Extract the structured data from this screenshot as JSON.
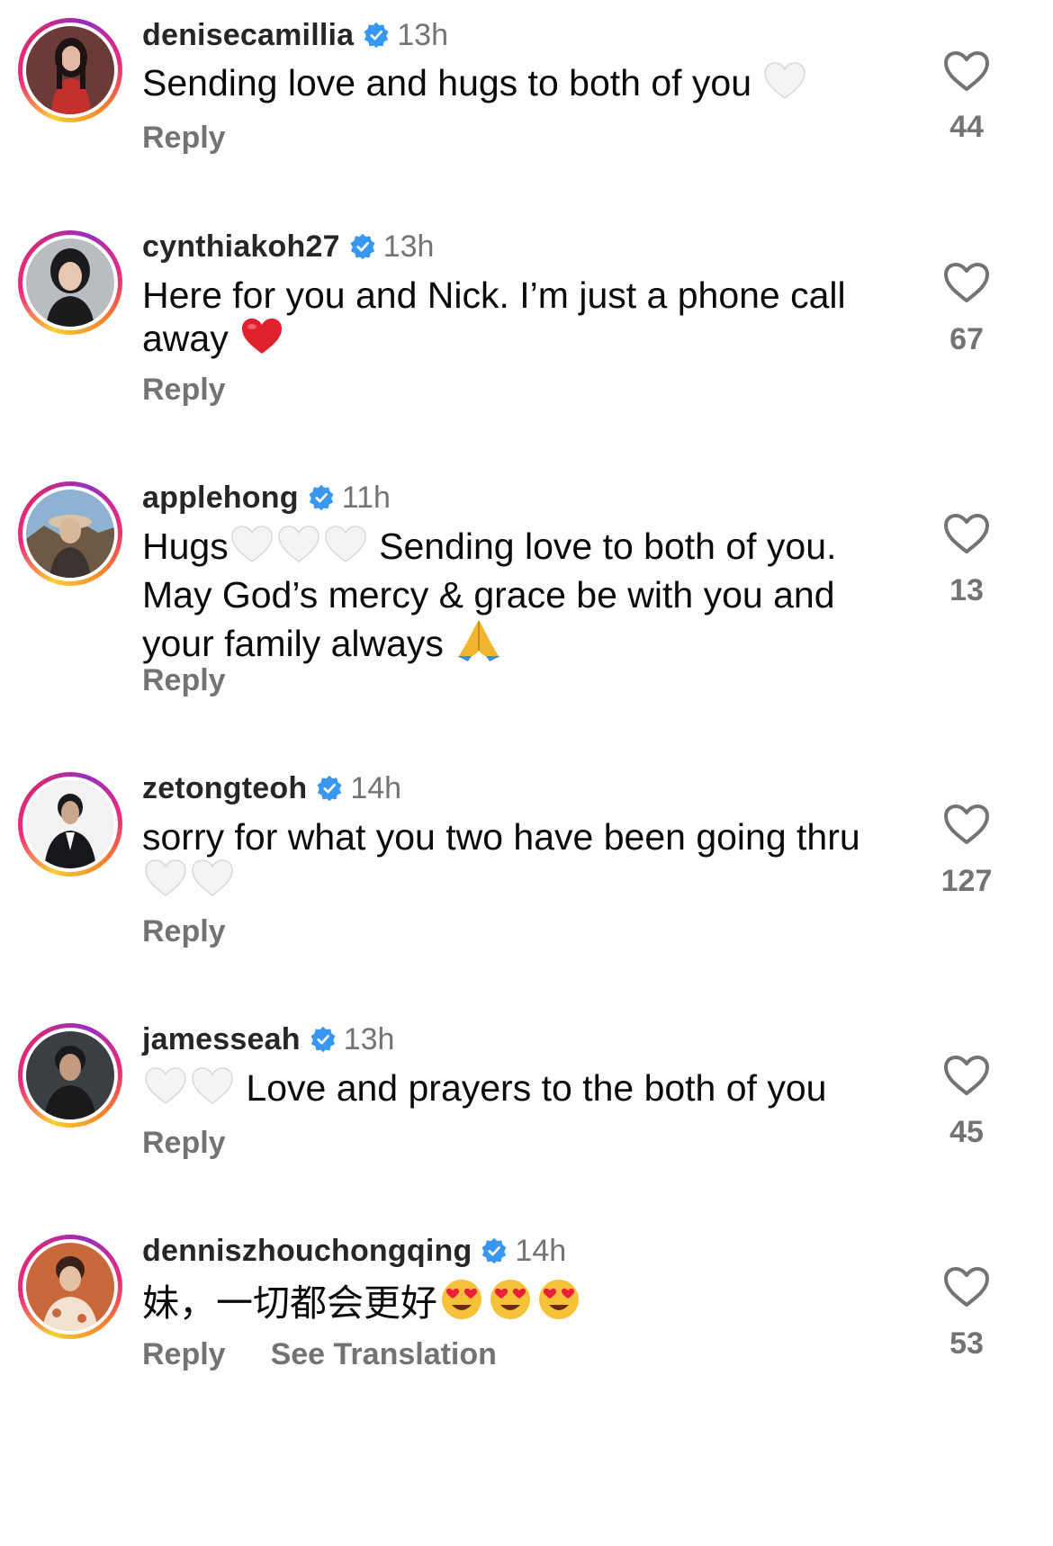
{
  "comments": [
    {
      "username": "denisecamillia",
      "time": "13h",
      "text_before": "Sending love and hugs to both of you ",
      "emoji_after": [
        "white-heart"
      ],
      "reply": "Reply",
      "likes": "44",
      "avatar_colors": [
        "#5a2a28",
        "#c4302b",
        "#1d1312"
      ]
    },
    {
      "username": "cynthiakoh27",
      "time": "13h",
      "text_before": "Here for you and Nick. I’m just a phone call away ",
      "emoji_after": [
        "red-heart"
      ],
      "reply": "Reply",
      "likes": "67",
      "avatar_colors": [
        "#b9bcc0",
        "#1b1b1d",
        "#e8c6b2"
      ]
    },
    {
      "username": "applehong",
      "time": "11h",
      "text_before": "Hugs",
      "emoji_mid": [
        "white-heart",
        "white-heart",
        "white-heart"
      ],
      "text_after": " Sending love to both of you. May God’s mercy & grace be with you and your family always ",
      "emoji_after": [
        "folded-hands"
      ],
      "reply": "Reply",
      "likes": "13",
      "avatar_colors": [
        "#8fb1d2",
        "#6e5a44",
        "#d9b79a"
      ]
    },
    {
      "username": "zetongteoh",
      "time": "14h",
      "text_before": "sorry for what you two have been going thru ",
      "emoji_after": [
        "white-heart",
        "white-heart"
      ],
      "reply": "Reply",
      "likes": "127",
      "avatar_colors": [
        "#f2f2f2",
        "#15171d",
        "#caa68d"
      ]
    },
    {
      "username": "jamesseah",
      "time": "13h",
      "emoji_lead": [
        "white-heart",
        "white-heart"
      ],
      "text_before": " Love and prayers to the both of you",
      "reply": "Reply",
      "likes": "45",
      "avatar_colors": [
        "#3b3f44",
        "#1a1a1a",
        "#c59b7f"
      ]
    },
    {
      "username": "denniszhouchongqing",
      "time": "14h",
      "text_before": "妹，一切都会更好",
      "emoji_after": [
        "heart-eyes",
        "heart-eyes",
        "heart-eyes"
      ],
      "reply": "Reply",
      "see_translation": "See Translation",
      "likes": "53",
      "avatar_colors": [
        "#c9683b",
        "#f1e3d0",
        "#3b2118"
      ]
    }
  ]
}
